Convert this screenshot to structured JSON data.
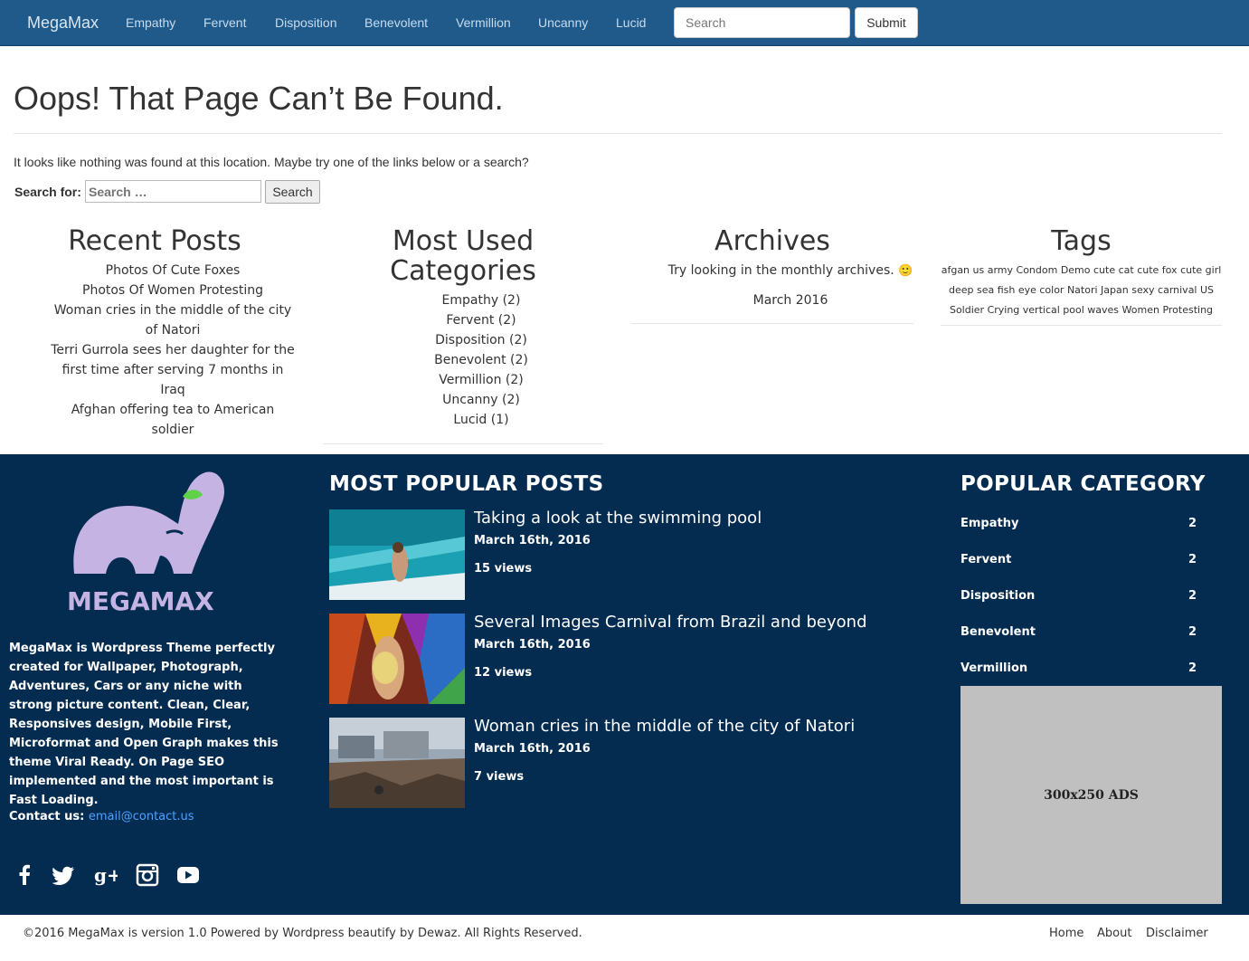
{
  "nav": {
    "brand": "MegaMax",
    "items": [
      "Empathy",
      "Fervent",
      "Disposition",
      "Benevolent",
      "Vermillion",
      "Uncanny",
      "Lucid"
    ],
    "search_placeholder": "Search",
    "submit_label": "Submit"
  },
  "main": {
    "title": "Oops! That Page Can’t Be Found.",
    "message": "It looks like nothing was found at this location. Maybe try one of the links below or a search?",
    "search_label": "Search for:",
    "search_placeholder": "Search …",
    "search_button": "Search"
  },
  "recent_posts": {
    "heading": "Recent Posts",
    "lines": [
      "Photos Of Cute Foxes",
      "Photos Of Women Protesting",
      "Woman cries in the middle of the city",
      "of Natori",
      "Terri Gurrola sees her daughter for the",
      "first time after serving 7 months in",
      "Iraq",
      "Afghan offering tea to American",
      "soldier"
    ]
  },
  "categories": {
    "heading_line1": "Most Used",
    "heading_line2": "Categories",
    "items": [
      "Empathy (2)",
      "Fervent (2)",
      "Disposition (2)",
      "Benevolent (2)",
      "Vermillion (2)",
      "Uncanny (2)",
      "Lucid (1)"
    ]
  },
  "archives": {
    "heading": "Archives",
    "hint": "Try looking in the monthly archives.",
    "emoji": "🙂",
    "month": "March 2016"
  },
  "tags": {
    "heading": "Tags",
    "line1": "afgan us army Condom Demo cute cat cute fox cute girl",
    "line2": "deep sea fish eye color Natori Japan sexy carnival US",
    "line3": "Soldier Crying vertical pool waves Women Protesting"
  },
  "footer": {
    "logo_text": "MEGAMAX",
    "about": "MegaMax is Wordpress Theme perfectly created for Wallpaper, Photograph, Adventures, Cars or any niche with strong picture content. Clean, Clear, Responsives design, Mobile First, Microformat and Open Graph makes this theme Viral Ready. On Page SEO implemented and the most important is Fast Loading.",
    "contact_label": "Contact us:",
    "contact_email": "email@contact.us",
    "social_icons": [
      "facebook-icon",
      "twitter-icon",
      "google-plus-icon",
      "instagram-icon",
      "youtube-icon"
    ],
    "popular_posts_heading": "MOST POPULAR POSTS",
    "popular_posts": [
      {
        "title": "Taking a look at the swimming pool",
        "date": "March 16th, 2016",
        "views": "15 views"
      },
      {
        "title": "Several Images Carnival from Brazil and beyond",
        "date": "March 16th, 2016",
        "views": "12 views"
      },
      {
        "title": "Woman cries in the middle of the city of Natori",
        "date": "March 16th, 2016",
        "views": "7 views"
      }
    ],
    "popular_category_heading": "POPULAR CATEGORY",
    "popular_categories": [
      {
        "name": "Empathy",
        "count": "2"
      },
      {
        "name": "Fervent",
        "count": "2"
      },
      {
        "name": "Disposition",
        "count": "2"
      },
      {
        "name": "Benevolent",
        "count": "2"
      },
      {
        "name": "Vermillion",
        "count": "2"
      }
    ],
    "ads_label": "300x250 ADS"
  },
  "bottom": {
    "copyright": "©2016 MegaMax is version 1.0 Powered by Wordpress beautify by Dewaz. All Rights Reserved.",
    "links": [
      "Home",
      "About",
      "Disclaimer"
    ]
  },
  "colors": {
    "navbar": "#1f5a8b",
    "footer": "#042b50",
    "link": "#4aa3ff",
    "logo": "#c5b4e3"
  }
}
